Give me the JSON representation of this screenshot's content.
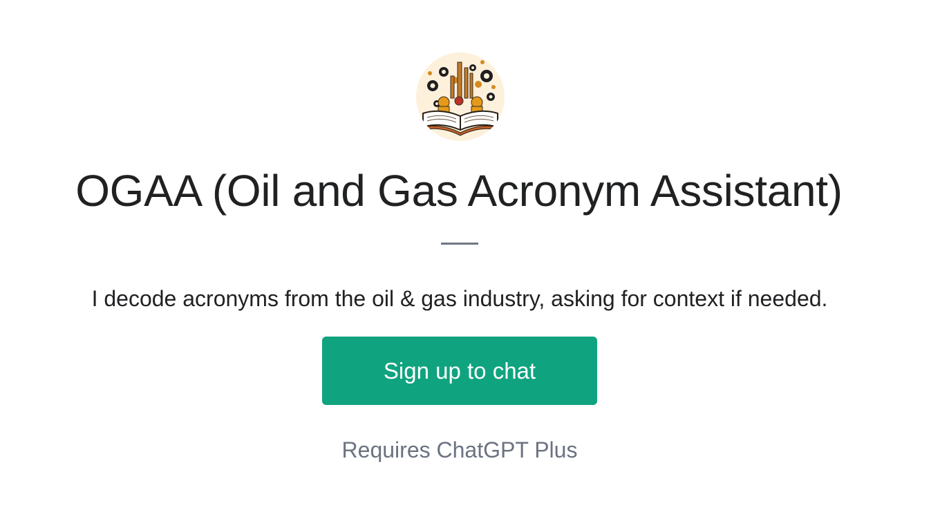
{
  "gpt": {
    "avatar_icon": "oil-gas-book-gears-icon",
    "title": "OGAA (Oil and Gas Acronym Assistant)",
    "description": "I decode acronyms from the oil & gas industry, asking for context if needed.",
    "signup_label": "Sign up to chat",
    "requirement": "Requires ChatGPT Plus"
  },
  "colors": {
    "accent": "#10a37f",
    "title_text": "#202123",
    "muted_text": "#6b7280",
    "divider": "#6e7681",
    "avatar_bg": "#fdf1dc"
  }
}
